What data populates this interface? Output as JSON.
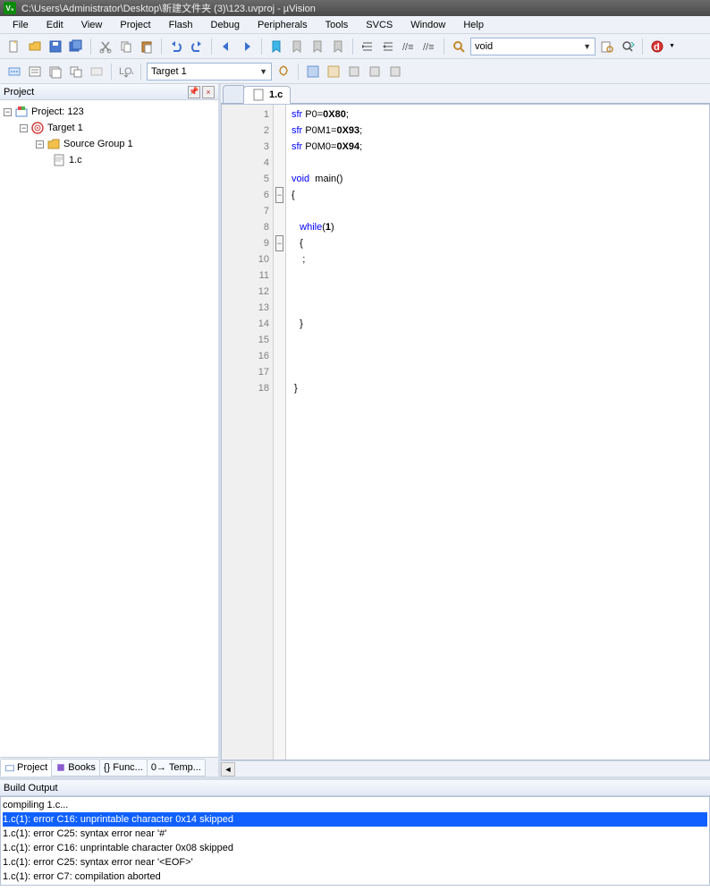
{
  "title": "C:\\Users\\Administrator\\Desktop\\新建文件夹 (3)\\123.uvproj - µVision",
  "menu": [
    "File",
    "Edit",
    "View",
    "Project",
    "Flash",
    "Debug",
    "Peripherals",
    "Tools",
    "SVCS",
    "Window",
    "Help"
  ],
  "combo_find": "void",
  "combo_target": "Target 1",
  "project_panel_title": "Project",
  "tree": {
    "root": "Project: 123",
    "target": "Target 1",
    "group": "Source Group 1",
    "file": "1.c"
  },
  "proj_tabs": [
    {
      "label": "Project"
    },
    {
      "label": "Books"
    },
    {
      "label": "{} Func..."
    },
    {
      "label": "0→ Temp..."
    }
  ],
  "editor_tab": "1.c",
  "code_lines": [
    {
      "n": 1,
      "tokens": [
        {
          "t": "sfr",
          "c": "blue"
        },
        {
          "t": " P0="
        },
        {
          "t": "0X80",
          "c": "num"
        },
        {
          "t": ";"
        }
      ]
    },
    {
      "n": 2,
      "tokens": [
        {
          "t": "sfr",
          "c": "blue"
        },
        {
          "t": " P0M1="
        },
        {
          "t": "0X93",
          "c": "num"
        },
        {
          "t": ";"
        }
      ]
    },
    {
      "n": 3,
      "tokens": [
        {
          "t": "sfr",
          "c": "blue"
        },
        {
          "t": " P0M0="
        },
        {
          "t": "0X94",
          "c": "num"
        },
        {
          "t": ";"
        }
      ]
    },
    {
      "n": 4,
      "tokens": []
    },
    {
      "n": 5,
      "tokens": [
        {
          "t": "void",
          "c": "blue"
        },
        {
          "t": "  main()"
        }
      ]
    },
    {
      "n": 6,
      "fold": "open",
      "tokens": [
        {
          "t": "{"
        }
      ]
    },
    {
      "n": 7,
      "tokens": []
    },
    {
      "n": 8,
      "tokens": [
        {
          "t": "   "
        },
        {
          "t": "while",
          "c": "blue"
        },
        {
          "t": "("
        },
        {
          "t": "1",
          "c": "num"
        },
        {
          "t": ")"
        }
      ]
    },
    {
      "n": 9,
      "fold": "open",
      "tokens": [
        {
          "t": "   {"
        }
      ]
    },
    {
      "n": 10,
      "tokens": [
        {
          "t": "    ;"
        }
      ]
    },
    {
      "n": 11,
      "tokens": []
    },
    {
      "n": 12,
      "tokens": []
    },
    {
      "n": 13,
      "tokens": []
    },
    {
      "n": 14,
      "tokens": [
        {
          "t": "   }"
        }
      ]
    },
    {
      "n": 15,
      "tokens": []
    },
    {
      "n": 16,
      "tokens": []
    },
    {
      "n": 17,
      "tokens": []
    },
    {
      "n": 18,
      "tokens": [
        {
          "t": " }"
        }
      ]
    }
  ],
  "build_title": "Build Output",
  "build_lines": [
    {
      "t": "compiling 1.c..."
    },
    {
      "t": "1.c(1): error C16: unprintable character 0x14 skipped",
      "hl": true
    },
    {
      "t": "1.c(1): error C25: syntax error near '#'"
    },
    {
      "t": "1.c(1): error C16: unprintable character 0x08 skipped"
    },
    {
      "t": "1.c(1): error C25: syntax error near '<EOF>'"
    },
    {
      "t": "1.c(1): error C7: compilation aborted"
    }
  ]
}
